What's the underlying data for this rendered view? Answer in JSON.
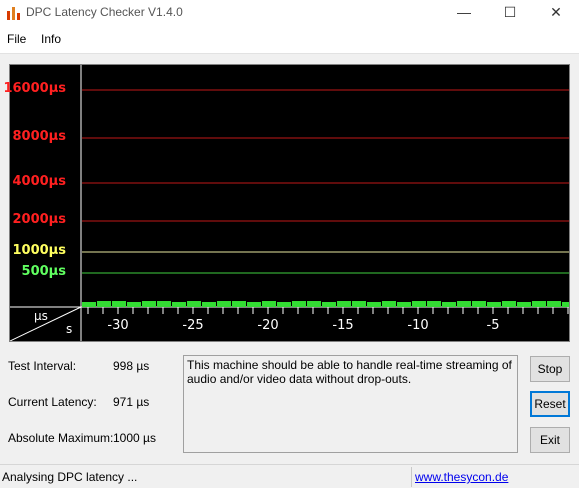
{
  "window": {
    "title": "DPC Latency Checker V1.4.0",
    "minimize": "—",
    "maximize": "☐",
    "close": "✕"
  },
  "menu": {
    "file": "File",
    "info": "Info"
  },
  "graph": {
    "y_labels": [
      {
        "text": "16000µs",
        "color": "#ff2020"
      },
      {
        "text": "8000µs",
        "color": "#ff2020"
      },
      {
        "text": "4000µs",
        "color": "#ff2020"
      },
      {
        "text": "2000µs",
        "color": "#ff2020"
      },
      {
        "text": "1000µs",
        "color": "#ffff60"
      },
      {
        "text": "500µs",
        "color": "#60ff60"
      }
    ],
    "x_labels": [
      "-30",
      "-25",
      "-20",
      "-15",
      "-10",
      "-5"
    ],
    "unit_y": "µs",
    "unit_x": "s",
    "bar_color": "#33dd33"
  },
  "stats": {
    "test_interval_label": "Test Interval:",
    "test_interval_value": "998 µs",
    "current_latency_label": "Current Latency:",
    "current_latency_value": "971 µs",
    "absolute_maximum_label": "Absolute Maximum:",
    "absolute_maximum_value": "1000 µs"
  },
  "message": "This machine should be able to handle real-time streaming of audio and/or video data without drop-outs.",
  "buttons": {
    "stop": "Stop",
    "reset": "Reset",
    "exit": "Exit"
  },
  "status": {
    "text": "Analysing DPC latency ...",
    "link": "www.thesycon.de"
  }
}
